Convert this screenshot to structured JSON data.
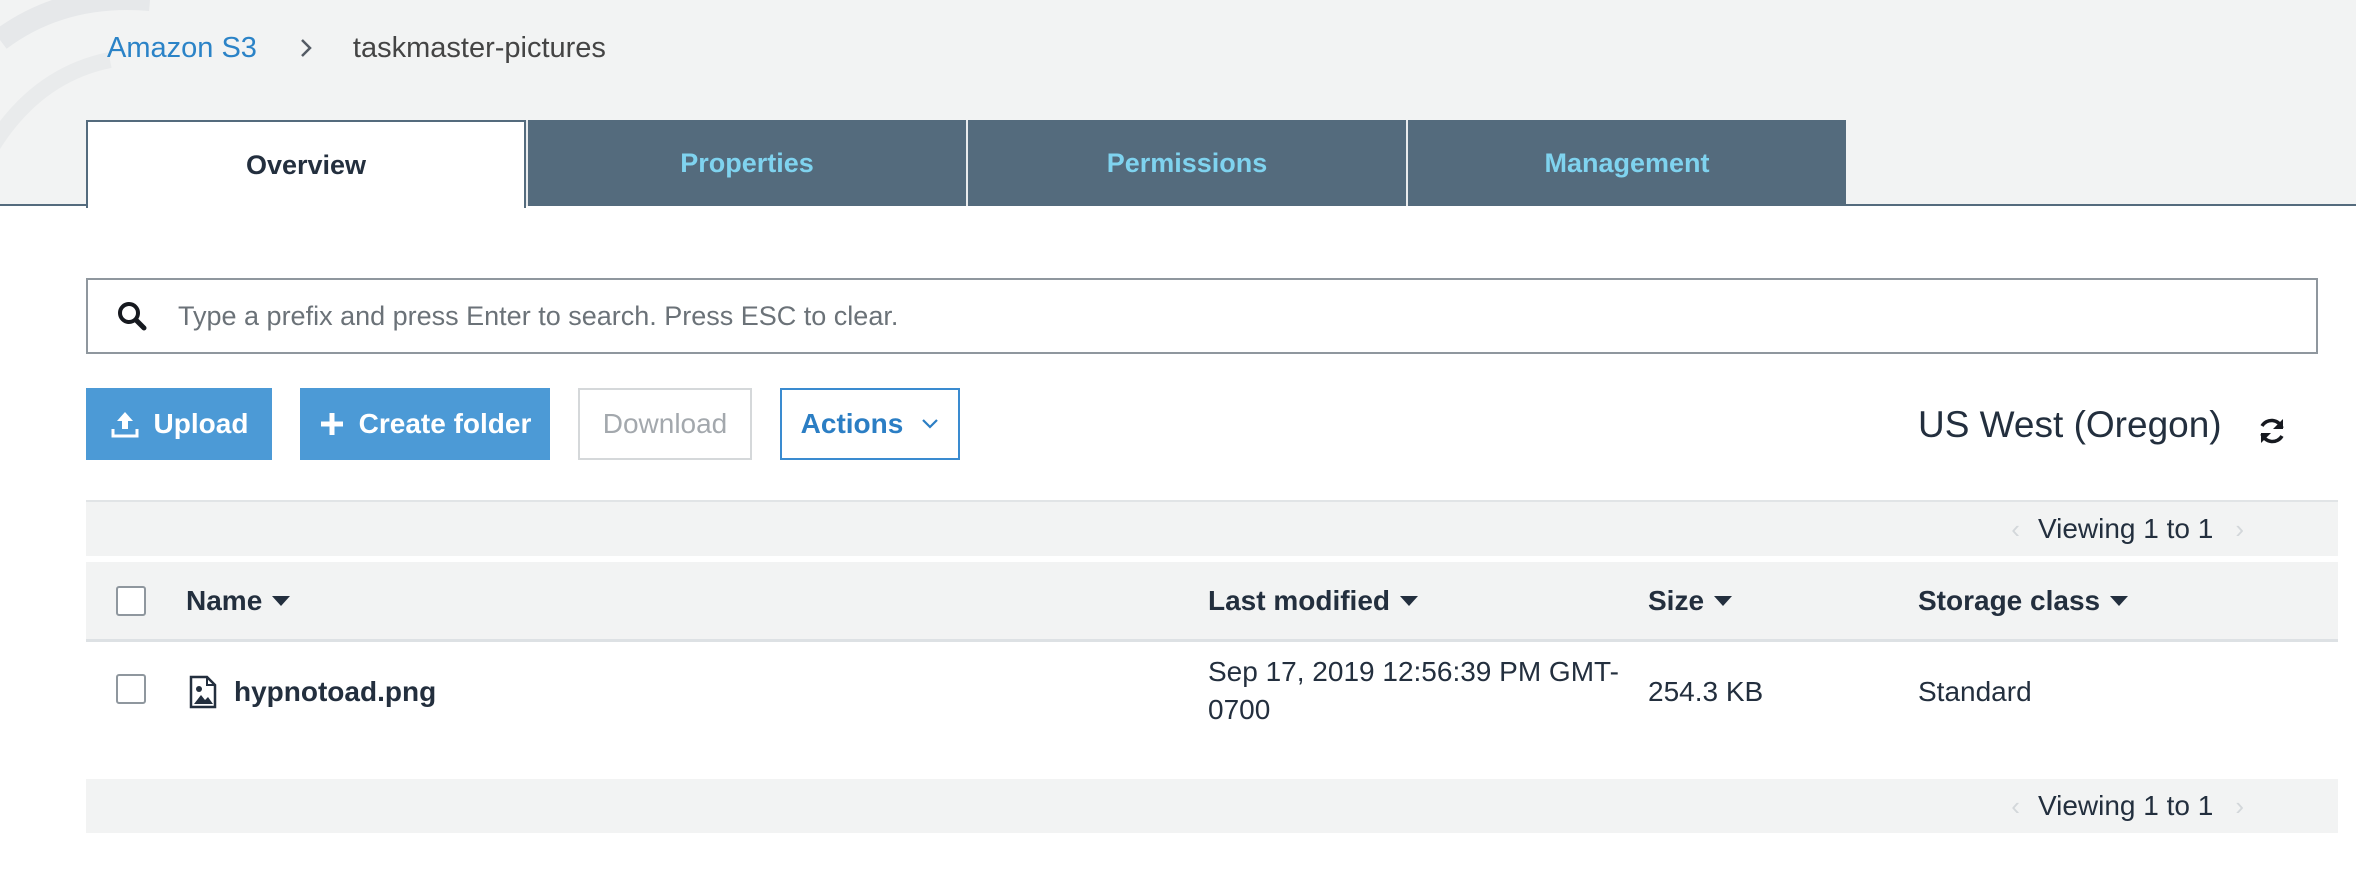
{
  "breadcrumb": {
    "root": "Amazon S3",
    "separator_icon": "chevron-right-icon",
    "current": "taskmaster-pictures"
  },
  "tabs": [
    {
      "label": "Overview",
      "active": true
    },
    {
      "label": "Properties",
      "active": false
    },
    {
      "label": "Permissions",
      "active": false
    },
    {
      "label": "Management",
      "active": false
    }
  ],
  "search": {
    "icon": "search-icon",
    "value": "",
    "placeholder": "Type a prefix and press Enter to search. Press ESC to clear."
  },
  "toolbar": {
    "upload_label": "Upload",
    "create_folder_label": "Create folder",
    "download_label": "Download",
    "actions_label": "Actions",
    "region": "US West (Oregon)",
    "refresh_icon": "refresh-icon"
  },
  "pagination": {
    "top_text": "Viewing 1 to 1",
    "bottom_text": "Viewing 1 to 1"
  },
  "table": {
    "columns": [
      "Name",
      "Last modified",
      "Size",
      "Storage class"
    ],
    "rows": [
      {
        "name": "hypnotoad.png",
        "icon": "image-file-icon",
        "last_modified": "Sep 17, 2019 12:56:39 PM GMT-0700",
        "size": "254.3 KB",
        "storage_class": "Standard"
      }
    ]
  },
  "colors": {
    "accent": "#4c9ad6",
    "tab_bar": "#546b7d",
    "tab_text": "#7fd3ef",
    "link": "#2b83c7",
    "header_bg": "#f2f3f3"
  }
}
